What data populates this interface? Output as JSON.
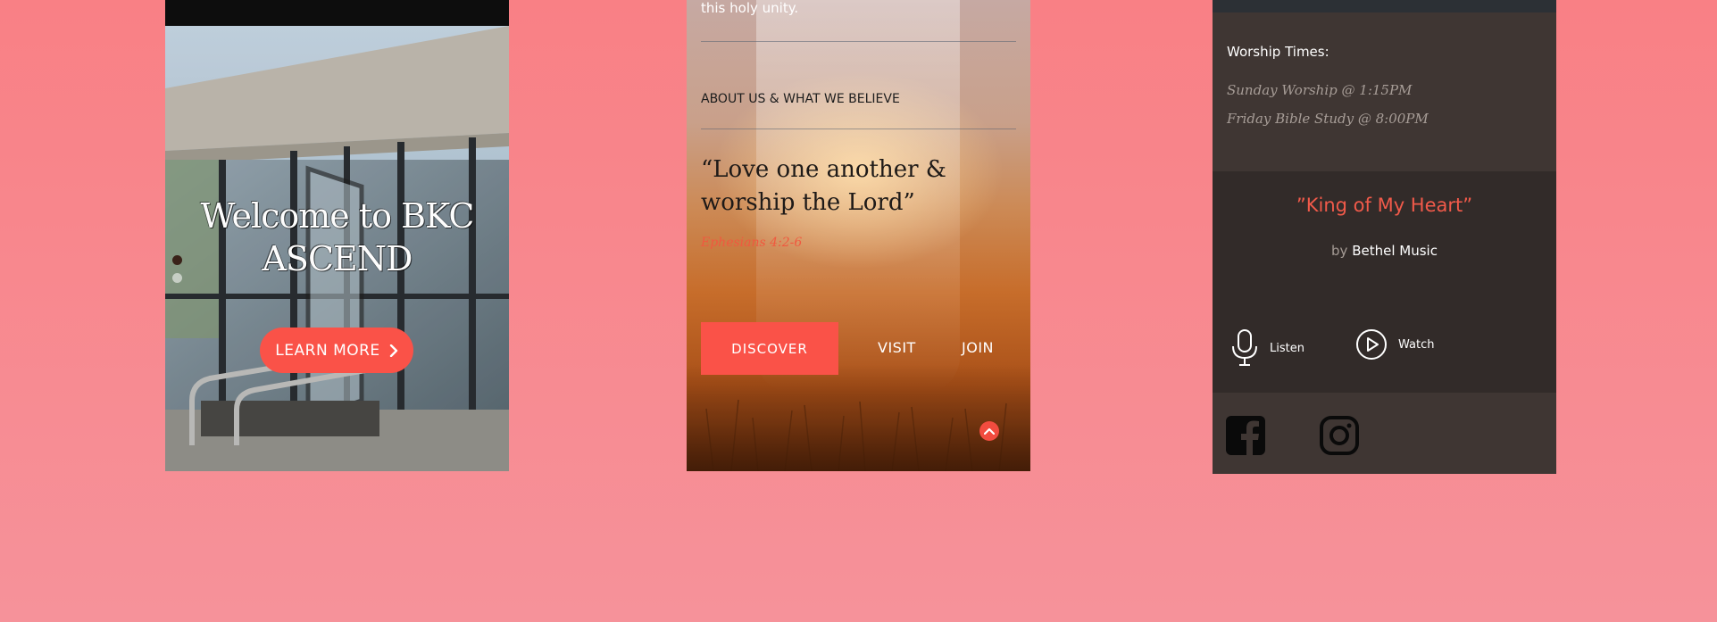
{
  "phone_home": {
    "welcome_line1": "Welcome to BKC",
    "welcome_line2": "ASCEND",
    "learn_more_label": "LEARN MORE",
    "icons": [
      "chevron-right-icon"
    ]
  },
  "phone_about": {
    "intro_tail": "this holy unity.",
    "section_label": "ABOUT US & WHAT WE BELIEVE",
    "quote_line1": "“Love one another &",
    "quote_line2": "worship the Lord”",
    "quote_reference": "Ephesians 4:2-6",
    "discover_label": "DISCOVER",
    "visit_label": "VISIT",
    "join_label": "JOIN",
    "icons": [
      "scroll-up-icon"
    ]
  },
  "phone_music": {
    "worship_title": "Worship Times:",
    "worship_items": [
      "Sunday Worship @ 1:15PM",
      "Friday Bible Study @ 8:00PM"
    ],
    "song_title": "”King of My Heart”",
    "song_by_prefix": "by",
    "song_artist": "Bethel Music",
    "listen_label": "Listen",
    "watch_label": "Watch",
    "icons": [
      "microphone-icon",
      "play-circle-icon",
      "facebook-icon",
      "instagram-icon"
    ]
  },
  "colors": {
    "background_top": "#f98085",
    "background_bottom": "#f6929a",
    "accent": "#fa5248",
    "dark_panel": "#3f3633",
    "darker_panel": "#322b29"
  }
}
